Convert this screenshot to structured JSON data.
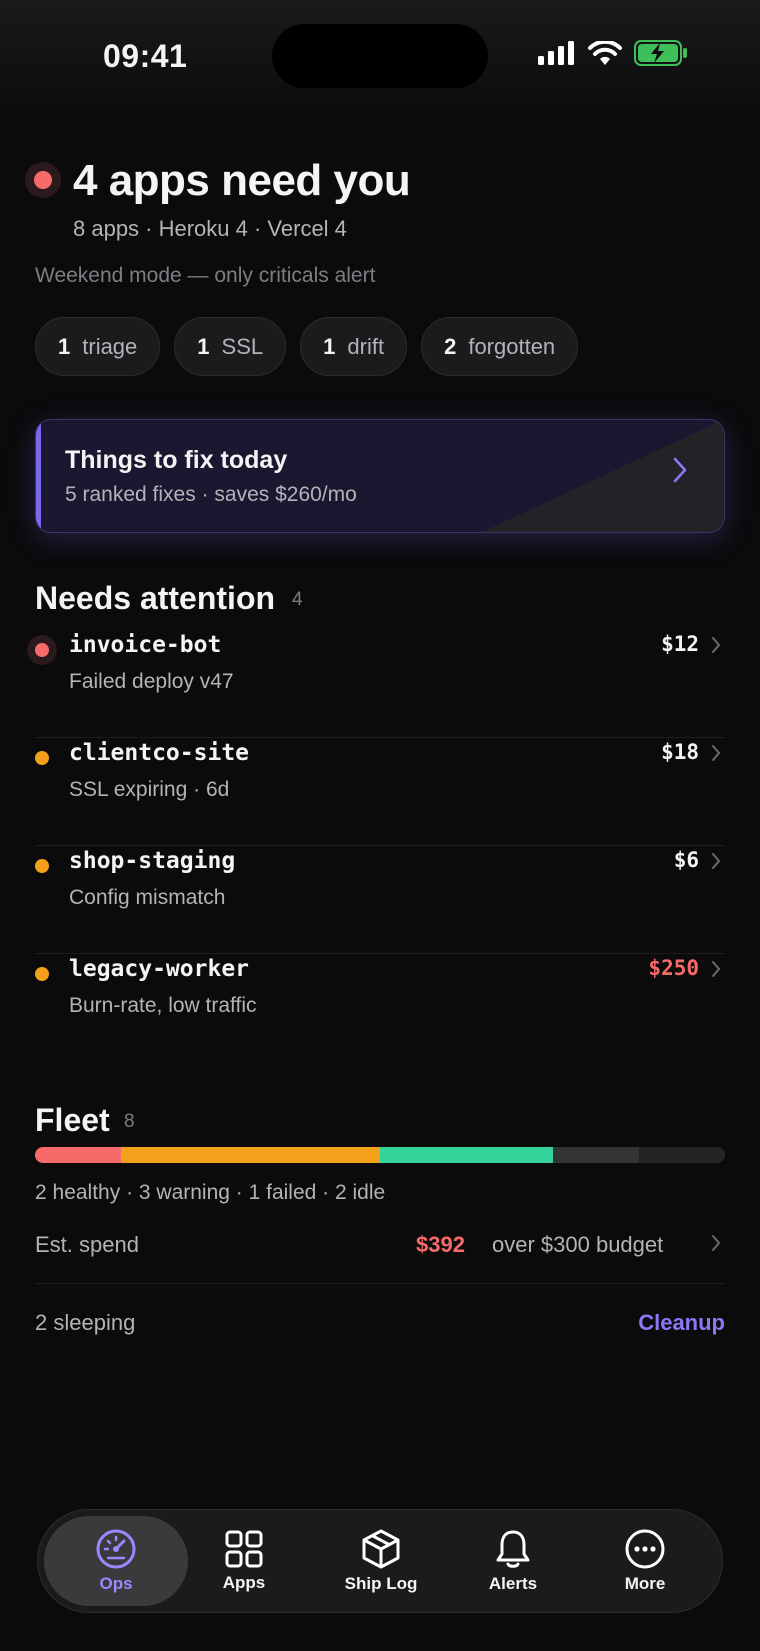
{
  "status_bar": {
    "time": "09:41"
  },
  "header": {
    "title": "4 apps need you",
    "subtitle": "8 apps · Heroku 4 · Vercel 4",
    "mode_note": "Weekend mode — only criticals alert",
    "status_color": "#f76a6a"
  },
  "chips": [
    {
      "count": "1",
      "label": "triage"
    },
    {
      "count": "1",
      "label": "SSL"
    },
    {
      "count": "1",
      "label": "drift"
    },
    {
      "count": "2",
      "label": "forgotten"
    }
  ],
  "fix_card": {
    "title": "Things to fix today",
    "subtitle": "5 ranked fixes · saves $260/mo",
    "accent": "#7a68f0"
  },
  "needs_attention": {
    "title": "Needs attention",
    "count": "4",
    "items": [
      {
        "name": "invoice-bot",
        "detail": "Failed deploy v47",
        "price": "$12",
        "severity": "critical",
        "dot_color": "#f76a6a",
        "price_color": "#f4f4f5"
      },
      {
        "name": "clientco-site",
        "detail": "SSL expiring · 6d",
        "price": "$18",
        "severity": "warning",
        "dot_color": "#f5a01a",
        "price_color": "#f4f4f5"
      },
      {
        "name": "shop-staging",
        "detail": "Config mismatch",
        "price": "$6",
        "severity": "warning",
        "dot_color": "#f5a01a",
        "price_color": "#f4f4f5"
      },
      {
        "name": "legacy-worker",
        "detail": "Burn-rate, low traffic",
        "price": "$250",
        "severity": "warning",
        "dot_color": "#f5a01a",
        "price_color": "#f76a6a"
      }
    ]
  },
  "fleet": {
    "title": "Fleet",
    "count": "8",
    "segments": [
      {
        "status": "failed",
        "count": 1,
        "color": "#f76a6a"
      },
      {
        "status": "warning",
        "count": 3,
        "color": "#f5a01a"
      },
      {
        "status": "healthy",
        "count": 2,
        "color": "#34d399"
      },
      {
        "status": "idle",
        "count": 1,
        "color": "#333336"
      },
      {
        "status": "idle",
        "count": 1,
        "color": "#242427"
      }
    ],
    "legend": "2 healthy · 3 warning · 1 failed · 2 idle",
    "spend_label": "Est. spend",
    "spend_value": "$392",
    "budget_note": "over $300 budget",
    "sleeping_label": "2 sleeping",
    "cleanup_label": "Cleanup"
  },
  "tabs": [
    {
      "label": "Ops",
      "icon": "gauge-icon",
      "active": true
    },
    {
      "label": "Apps",
      "icon": "grid-icon",
      "active": false
    },
    {
      "label": "Ship Log",
      "icon": "package-icon",
      "active": false
    },
    {
      "label": "Alerts",
      "icon": "bell-icon",
      "active": false
    },
    {
      "label": "More",
      "icon": "ellipsis-circle-icon",
      "active": false
    }
  ]
}
